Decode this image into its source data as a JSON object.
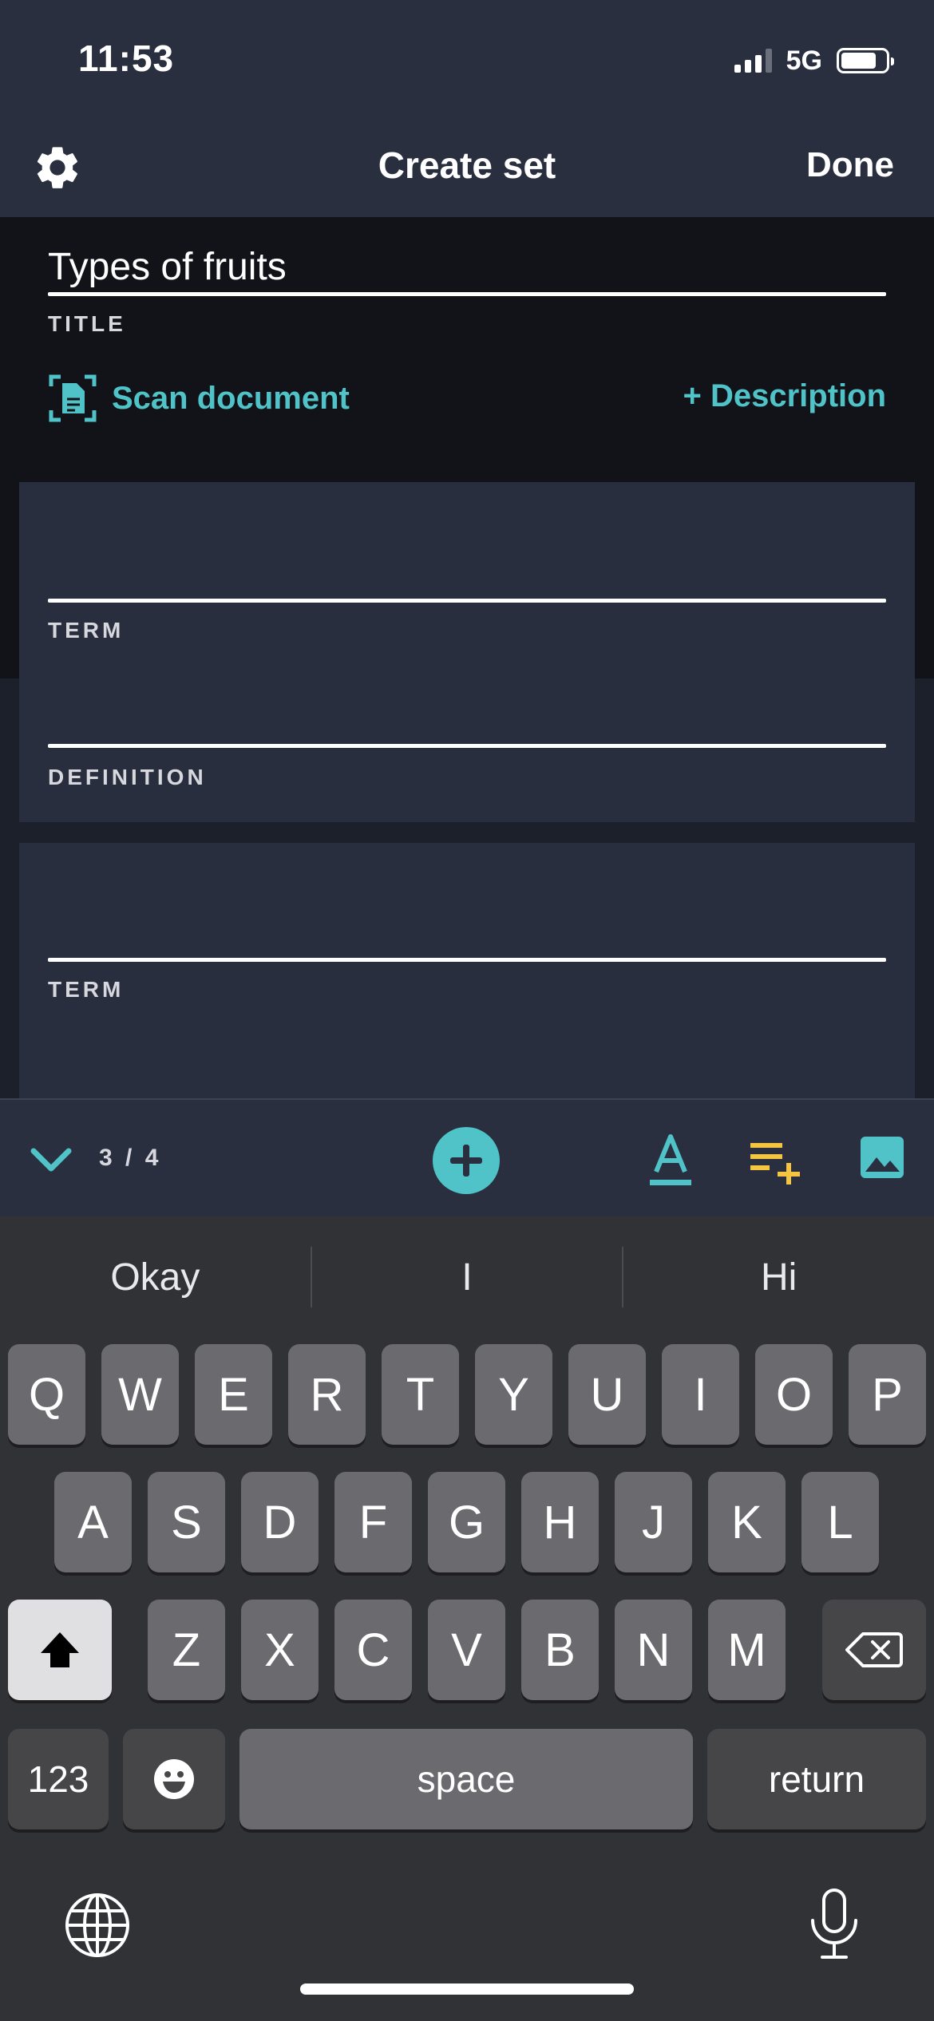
{
  "status_bar": {
    "time": "11:53",
    "network": "5G",
    "battery_level": 0.8
  },
  "nav": {
    "title": "Create set",
    "done_label": "Done"
  },
  "set": {
    "title_value": "Types of fruits",
    "title_label": "TITLE",
    "scan_label": "Scan document",
    "description_label": "+ Description"
  },
  "cards": [
    {
      "term_value": "",
      "term_label": "TERM",
      "definition_value": "",
      "definition_label": "DEFINITION"
    },
    {
      "term_value": "",
      "term_label": "TERM"
    }
  ],
  "toolbar": {
    "count": "3 / 4"
  },
  "keyboard": {
    "suggestions": [
      "Okay",
      "I",
      "Hi"
    ],
    "row1": [
      "Q",
      "W",
      "E",
      "R",
      "T",
      "Y",
      "U",
      "I",
      "O",
      "P"
    ],
    "row2": [
      "A",
      "S",
      "D",
      "F",
      "G",
      "H",
      "J",
      "K",
      "L"
    ],
    "row3": [
      "Z",
      "X",
      "C",
      "V",
      "B",
      "N",
      "M"
    ],
    "numbers_label": "123",
    "space_label": "space",
    "return_label": "return"
  },
  "colors": {
    "accent": "#4fc3c8",
    "highlight": "#f5c542",
    "header": "#2a2f40",
    "card": "#292e3e"
  }
}
